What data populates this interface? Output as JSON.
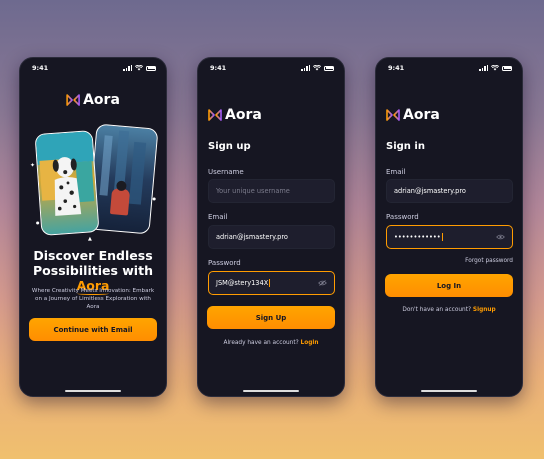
{
  "status": {
    "time": "9:41"
  },
  "brand": {
    "name": "Aora"
  },
  "onboarding": {
    "title_line1": "Discover Endless",
    "title_line2": "Possibilities with",
    "title_accent": "Aora",
    "subtitle": "Where Creativity Meets Innovation: Embark on a Journey of Limitless Exploration with Aora",
    "cta": "Continue with Email"
  },
  "signup": {
    "title": "Sign up",
    "username_label": "Username",
    "username_placeholder": "Your unique username",
    "email_label": "Email",
    "email_value": "adrian@jsmastery.pro",
    "password_label": "Password",
    "password_value": "JSM@stery134X",
    "submit": "Sign Up",
    "prompt": "Already have an account?",
    "prompt_link": "Login"
  },
  "signin": {
    "title": "Sign in",
    "email_label": "Email",
    "email_value": "adrian@jsmastery.pro",
    "password_label": "Password",
    "password_masked": "••••••••••••",
    "forgot": "Forgot password",
    "submit": "Log In",
    "prompt": "Don't have an account?",
    "prompt_link": "Signup"
  },
  "colors": {
    "accent": "#FF9C01",
    "background": "#161622",
    "field": "#1E1E2D"
  }
}
